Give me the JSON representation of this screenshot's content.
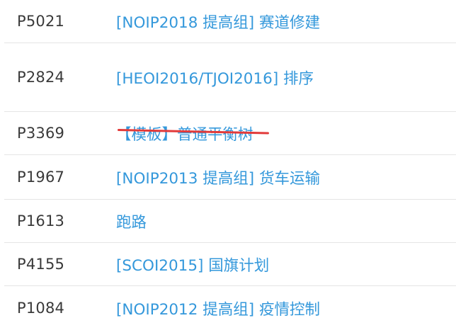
{
  "problems": [
    {
      "id": "P5021",
      "title": "[NOIP2018 提高组] 赛道修建"
    },
    {
      "id": "P2824",
      "title": "[HEOI2016/TJOI2016] 排序"
    },
    {
      "id": "P3369",
      "title": "【模板】普通平衡树",
      "struck": true
    },
    {
      "id": "P1967",
      "title": "[NOIP2013 提高组] 货车运输"
    },
    {
      "id": "P1613",
      "title": "跑路"
    },
    {
      "id": "P4155",
      "title": "[SCOI2015] 国旗计划"
    },
    {
      "id": "P1084",
      "title": "[NOIP2012 提高组] 疫情控制"
    }
  ],
  "colors": {
    "link": "#3498db",
    "strike": "#e23a3a",
    "separator": "#e5e5e5"
  }
}
